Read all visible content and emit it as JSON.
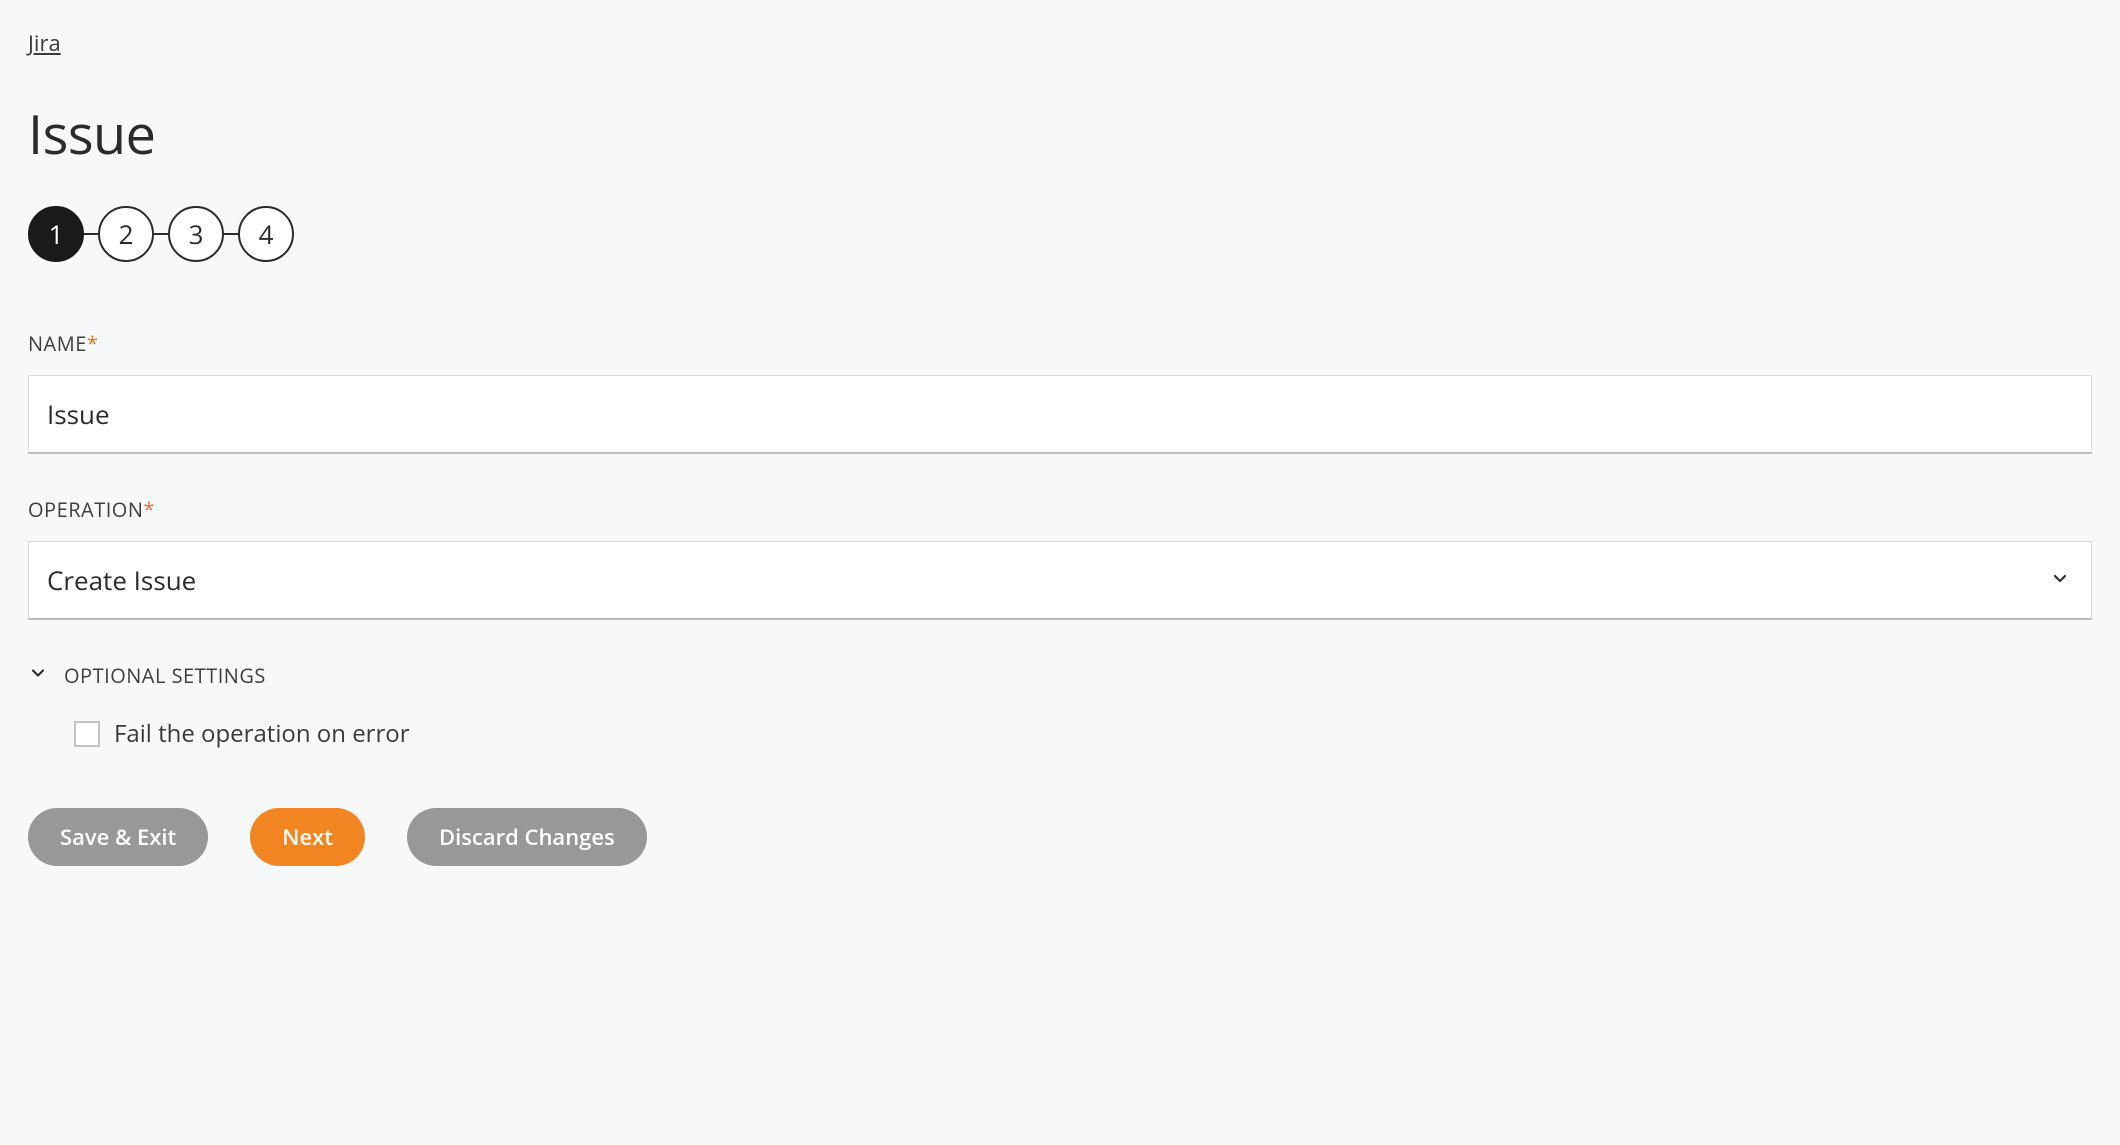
{
  "breadcrumb": {
    "label": "Jira"
  },
  "page": {
    "title": "Issue"
  },
  "stepper": {
    "steps": [
      "1",
      "2",
      "3",
      "4"
    ],
    "activeIndex": 0
  },
  "form": {
    "name": {
      "label": "NAME",
      "required": true,
      "value": "Issue"
    },
    "operation": {
      "label": "OPERATION",
      "required": true,
      "value": "Create Issue"
    }
  },
  "optional": {
    "header": "OPTIONAL SETTINGS",
    "failOnError": {
      "label": "Fail the operation on error",
      "checked": false
    }
  },
  "buttons": {
    "saveExit": "Save & Exit",
    "next": "Next",
    "discard": "Discard Changes"
  }
}
